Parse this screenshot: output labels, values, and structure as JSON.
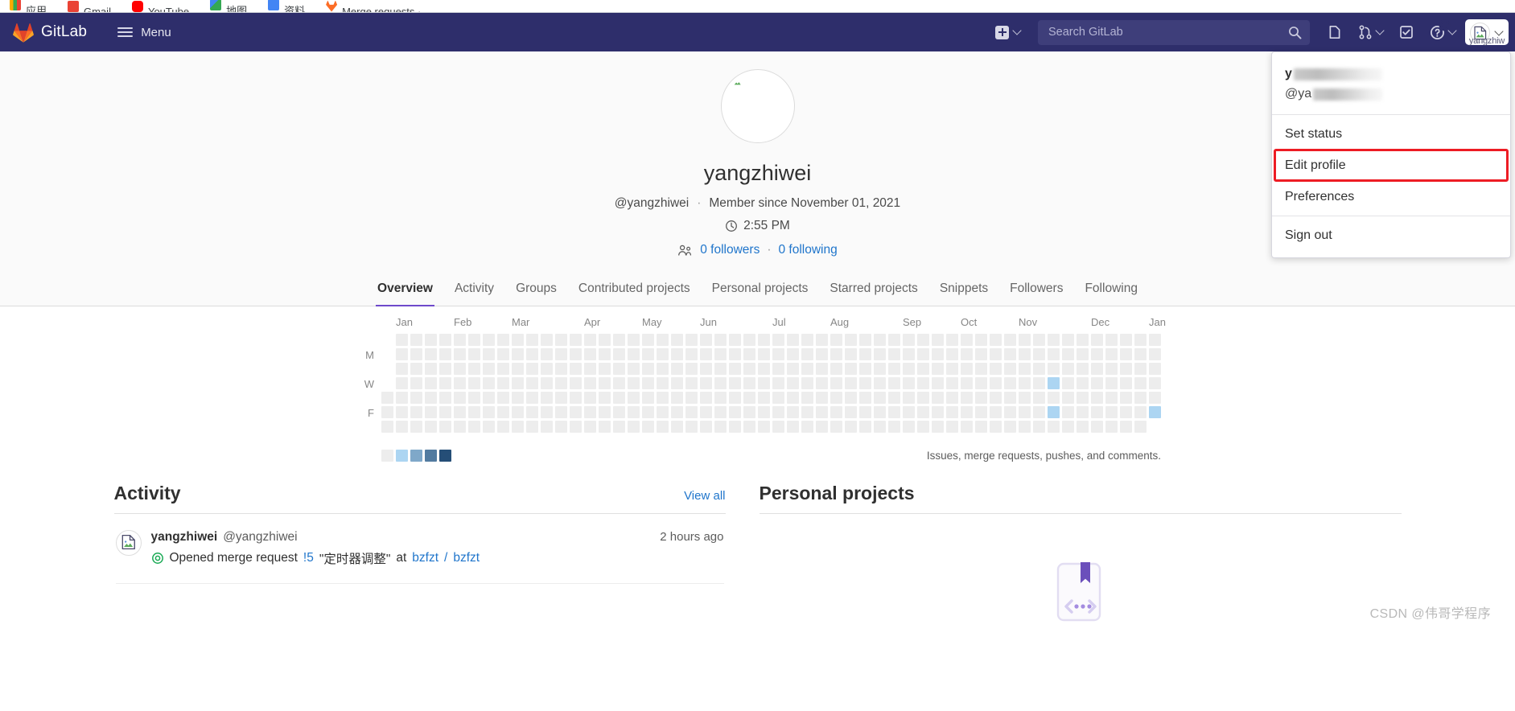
{
  "browser": {
    "bookmarks": [
      {
        "label": "应用",
        "color": "#f9ab00"
      },
      {
        "label": "Gmail",
        "color": "#ea4335"
      },
      {
        "label": "YouTube",
        "color": "#ff0000"
      },
      {
        "label": "地图",
        "color": "#34a853"
      },
      {
        "label": "资料",
        "color": "#4285f4"
      },
      {
        "label": "Merge requests ·",
        "color": "#fc6d26"
      }
    ]
  },
  "navbar": {
    "brand": "GitLab",
    "menu_label": "Menu",
    "create_new_label": "+",
    "search_placeholder": "Search GitLab",
    "search_value": "",
    "icons": [
      {
        "name": "issues-icon",
        "label": "Issues"
      },
      {
        "name": "merge-requests-icon",
        "label": "Merge requests"
      },
      {
        "name": "todos-icon",
        "label": "To-Do List"
      },
      {
        "name": "help-icon",
        "label": "Help"
      }
    ],
    "user_avatar_label": "yangzhiw"
  },
  "user_dropdown": {
    "name_prefix": "y",
    "handle_prefix": "@ya",
    "items": [
      {
        "label": "Set status",
        "highlighted": false
      },
      {
        "label": "Edit profile",
        "highlighted": true
      },
      {
        "label": "Preferences",
        "highlighted": false
      }
    ],
    "sign_out": "Sign out"
  },
  "profile": {
    "name": "yangzhiwei",
    "handle": "@yangzhiwei",
    "separator": "·",
    "member_since": "Member since November 01, 2021",
    "local_time": "2:55 PM",
    "followers": "0 followers",
    "following": "0 following"
  },
  "tabs": [
    {
      "label": "Overview",
      "active": true
    },
    {
      "label": "Activity",
      "active": false
    },
    {
      "label": "Groups",
      "active": false
    },
    {
      "label": "Contributed projects",
      "active": false
    },
    {
      "label": "Personal projects",
      "active": false
    },
    {
      "label": "Starred projects",
      "active": false
    },
    {
      "label": "Snippets",
      "active": false
    },
    {
      "label": "Followers",
      "active": false
    },
    {
      "label": "Following",
      "active": false
    }
  ],
  "calendar": {
    "months": [
      "Jan",
      "Feb",
      "Mar",
      "Apr",
      "May",
      "Jun",
      "Jul",
      "Aug",
      "Sep",
      "Oct",
      "Nov",
      "Dec",
      "Jan"
    ],
    "month_col_index": [
      1,
      5,
      9,
      14,
      18,
      22,
      27,
      31,
      36,
      40,
      44,
      49,
      53
    ],
    "day_labels": [
      "",
      "M",
      "",
      "W",
      "",
      "F",
      ""
    ],
    "total_columns": 54,
    "note": "Issues, merge requests, pushes, and comments.",
    "legend_levels": [
      0,
      1,
      2,
      3,
      4
    ],
    "legend_colors": [
      "#ededed",
      "#acd5f2",
      "#7fa8c9",
      "#527ba0",
      "#254e77"
    ],
    "empty_cells": [
      [
        0,
        0
      ],
      [
        0,
        1
      ],
      [
        0,
        2
      ],
      [
        0,
        3
      ],
      [
        53,
        6
      ]
    ],
    "contributions": [
      {
        "col": 46,
        "row": 3,
        "level": 1
      },
      {
        "col": 46,
        "row": 5,
        "level": 1
      },
      {
        "col": 53,
        "row": 5,
        "level": 1
      }
    ]
  },
  "activity": {
    "title": "Activity",
    "view_all": "View all",
    "items": [
      {
        "user": "yangzhiwei",
        "handle": "@yangzhiwei",
        "time": "2 hours ago",
        "action": "Opened merge request",
        "ref": "!5",
        "subject": "\"定时器调整\"",
        "at": "at",
        "project_namespace": "bzfzt",
        "project_sep": "/",
        "project_name": "bzfzt"
      }
    ]
  },
  "personal_projects": {
    "title": "Personal projects"
  },
  "watermark": "CSDN @伟哥学程序",
  "colors": {
    "navbar_bg": "#2e2e6b",
    "accent": "#6e49cb",
    "link": "#1f75cb",
    "highlight_box": "#ed1c24"
  }
}
